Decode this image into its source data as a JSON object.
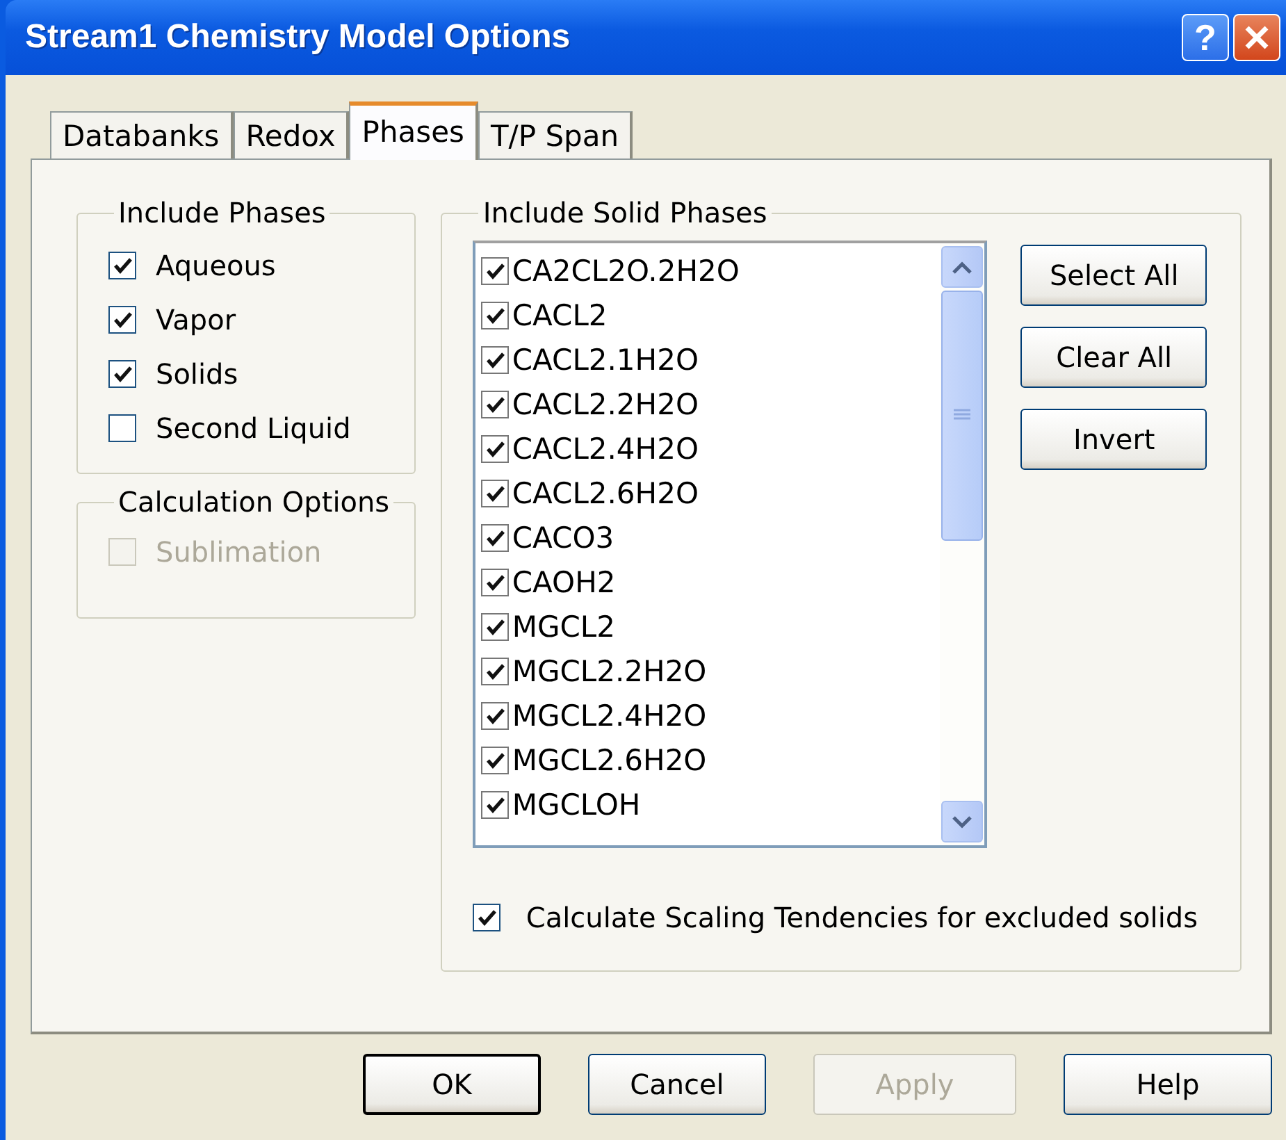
{
  "window": {
    "title": "Stream1 Chemistry Model Options",
    "help_button": "?"
  },
  "tabs": [
    {
      "label": "Databanks",
      "selected": false
    },
    {
      "label": "Redox",
      "selected": false
    },
    {
      "label": "Phases",
      "selected": true
    },
    {
      "label": "T/P Span",
      "selected": false
    }
  ],
  "include_phases": {
    "title": "Include Phases",
    "items": [
      {
        "label": "Aqueous",
        "checked": true,
        "disabled": false
      },
      {
        "label": "Vapor",
        "checked": true,
        "disabled": false
      },
      {
        "label": "Solids",
        "checked": true,
        "disabled": false
      },
      {
        "label": "Second Liquid",
        "checked": false,
        "disabled": false
      }
    ]
  },
  "calculation_options": {
    "title": "Calculation Options",
    "items": [
      {
        "label": "Sublimation",
        "checked": false,
        "disabled": true
      }
    ]
  },
  "solid_phases": {
    "title": "Include Solid Phases",
    "items": [
      {
        "label": "CA2CL2O.2H2O",
        "checked": true
      },
      {
        "label": "CACL2",
        "checked": true
      },
      {
        "label": "CACL2.1H2O",
        "checked": true
      },
      {
        "label": "CACL2.2H2O",
        "checked": true
      },
      {
        "label": "CACL2.4H2O",
        "checked": true
      },
      {
        "label": "CACL2.6H2O",
        "checked": true
      },
      {
        "label": "CACO3",
        "checked": true
      },
      {
        "label": "CAOH2",
        "checked": true
      },
      {
        "label": "MGCL2",
        "checked": true
      },
      {
        "label": "MGCL2.2H2O",
        "checked": true
      },
      {
        "label": "MGCL2.4H2O",
        "checked": true
      },
      {
        "label": "MGCL2.6H2O",
        "checked": true
      },
      {
        "label": "MGCLOH",
        "checked": true
      }
    ],
    "buttons": [
      "Select All",
      "Clear All",
      "Invert"
    ],
    "scaling_option": {
      "label": "Calculate Scaling Tendencies for excluded solids",
      "checked": true
    }
  },
  "buttons": [
    {
      "label": "OK",
      "default": true,
      "disabled": false
    },
    {
      "label": "Cancel",
      "default": false,
      "disabled": false
    },
    {
      "label": "Apply",
      "default": false,
      "disabled": true
    },
    {
      "label": "Help",
      "default": false,
      "disabled": false
    }
  ]
}
